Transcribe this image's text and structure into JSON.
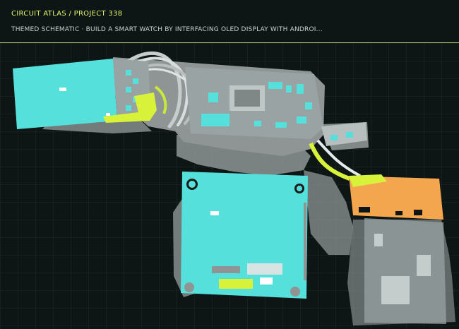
{
  "header": {
    "breadcrumb": "CIRCUIT ATLAS / PROJECT 338",
    "subtitle": "THEMED SCHEMATIC · BUILD A SMART WATCH BY INTERFACING OLED DISPLAY WITH ANDROI..."
  },
  "palette": {
    "background": "#0d1515",
    "grid": "#1f2b2b",
    "accent": "#e3f56b",
    "board": "#55e0dc",
    "shadow": "#9aa0a0",
    "orange": "#f4a64e",
    "lime": "#d8f23a"
  }
}
